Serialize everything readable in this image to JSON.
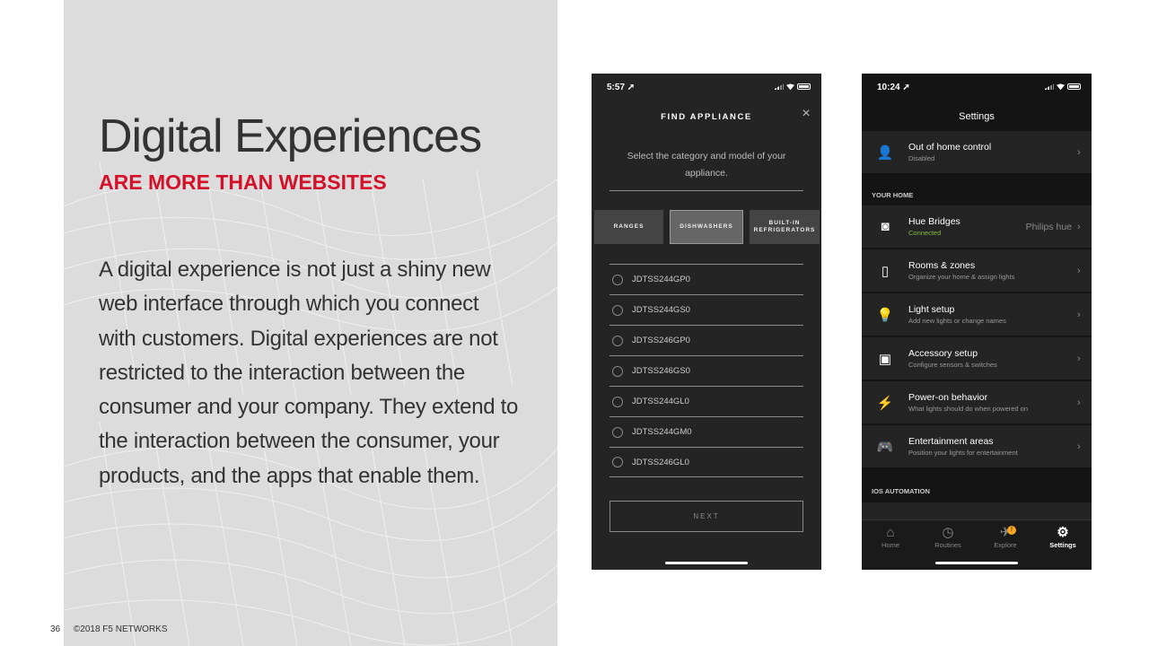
{
  "slide": {
    "title": "Digital Experiences",
    "subtitle": "ARE MORE THAN WEBSITES",
    "body": "A digital experience is not just a shiny new web interface through which you connect with customers. Digital experiences are not restricted to the interaction between the consumer and your company. They extend to the interaction between the consumer, your products, and the apps that enable them.",
    "page_number": "36",
    "copyright": "©2018 F5 NETWORKS",
    "accent_color": "#d5112a"
  },
  "phone1": {
    "status_time": "5:57 ➚",
    "title": "FIND APPLIANCE",
    "close_icon": "×",
    "instruction": "Select the category and model of your appliance.",
    "categories": [
      "RANGES",
      "DISHWASHERS",
      "BUILT-IN REFRIGERATORS"
    ],
    "selected_category": "DISHWASHERS",
    "models": [
      "JDTSS244GP0",
      "JDTSS244GS0",
      "JDTSS246GP0",
      "JDTSS246GS0",
      "JDTSS244GL0",
      "JDTSS244GM0",
      "JDTSS246GL0"
    ],
    "next_label": "NEXT"
  },
  "phone2": {
    "status_time": "10:24 ➚",
    "title": "Settings",
    "top_item": {
      "label": "Out of home control",
      "sub": "Disabled",
      "icon": "👤"
    },
    "section_home": "YOUR HOME",
    "items": [
      {
        "label": "Hue Bridges",
        "sub": "Connected",
        "value": "Philips hue",
        "icon": "◙"
      },
      {
        "label": "Rooms & zones",
        "sub": "Organize your home & assign lights",
        "value": "",
        "icon": "▯"
      },
      {
        "label": "Light setup",
        "sub": "Add new lights or change names",
        "value": "",
        "icon": "💡"
      },
      {
        "label": "Accessory setup",
        "sub": "Configure sensors & switches",
        "value": "",
        "icon": "▣"
      },
      {
        "label": "Power-on behavior",
        "sub": "What lights should do when powered on",
        "value": "",
        "icon": "⚡"
      },
      {
        "label": "Entertainment areas",
        "sub": "Position your lights for entertainment",
        "value": "",
        "icon": "🎮"
      }
    ],
    "section_ios": "IOS AUTOMATION",
    "tabs": [
      {
        "label": "Home",
        "icon": "⌂"
      },
      {
        "label": "Routines",
        "icon": "◷"
      },
      {
        "label": "Explore",
        "icon": "✈",
        "badge": "!"
      },
      {
        "label": "Settings",
        "icon": "⚙"
      }
    ],
    "active_tab": "Settings",
    "chevron": "›"
  }
}
